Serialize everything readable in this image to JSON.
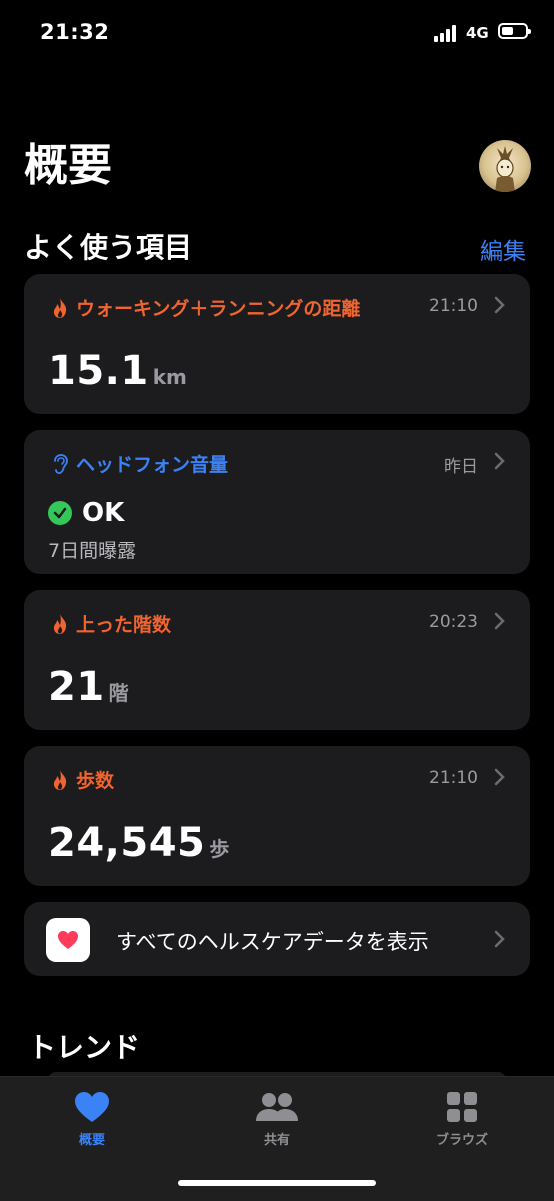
{
  "status": {
    "time": "21:32",
    "network": "4G"
  },
  "header": {
    "title": "概要"
  },
  "favorites": {
    "title": "よく使う項目",
    "edit_label": "編集",
    "cards": [
      {
        "title": "ウォーキング＋ランニングの距離",
        "time": "21:10",
        "value": "15.1",
        "unit": "km",
        "icon": "flame-icon",
        "color": "#f0642f"
      },
      {
        "title": "ヘッドフォン音量",
        "time": "昨日",
        "status": "OK",
        "subtitle": "7日間曝露",
        "icon": "ear-icon",
        "color": "#3b82f6"
      },
      {
        "title": "上った階数",
        "time": "20:23",
        "value": "21",
        "unit": "階",
        "icon": "flame-icon",
        "color": "#f0642f"
      },
      {
        "title": "歩数",
        "time": "21:10",
        "value": "24,545",
        "unit": "歩",
        "icon": "flame-icon",
        "color": "#f0642f"
      }
    ],
    "all_data_label": "すべてのヘルスケアデータを表示"
  },
  "trends": {
    "title": "トレンド"
  },
  "tabs": [
    {
      "label": "概要",
      "icon": "heart-icon",
      "selected": true
    },
    {
      "label": "共有",
      "icon": "people-icon",
      "selected": false
    },
    {
      "label": "ブラウズ",
      "icon": "grid-icon",
      "selected": false
    }
  ],
  "colors": {
    "accent": "#3b82f6",
    "activity": "#f0642f",
    "card": "#1c1c1e",
    "ok": "#34c759"
  }
}
